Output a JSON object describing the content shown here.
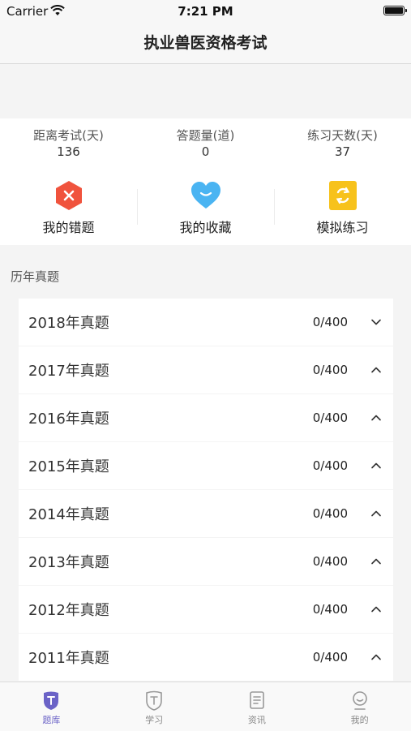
{
  "status_bar": {
    "carrier": "Carrier",
    "time": "7:21 PM"
  },
  "nav": {
    "title": "执业兽医资格考试"
  },
  "stats": [
    {
      "label": "距离考试(天)",
      "value": "136"
    },
    {
      "label": "答题量(道)",
      "value": "0"
    },
    {
      "label": "练习天数(天)",
      "value": "37"
    }
  ],
  "actions": [
    {
      "label": "我的错题",
      "icon": "wrong-questions-icon",
      "color": "#f0533d"
    },
    {
      "label": "我的收藏",
      "icon": "favorites-heart-icon",
      "color": "#4ab4f2"
    },
    {
      "label": "模拟练习",
      "icon": "mock-practice-icon",
      "color": "#f7c21c"
    }
  ],
  "section_title": "历年真题",
  "years": [
    {
      "title": "2018年真题",
      "progress": "0/400",
      "chevron": "down"
    },
    {
      "title": "2017年真题",
      "progress": "0/400",
      "chevron": "up"
    },
    {
      "title": "2016年真题",
      "progress": "0/400",
      "chevron": "up"
    },
    {
      "title": "2015年真题",
      "progress": "0/400",
      "chevron": "up"
    },
    {
      "title": "2014年真题",
      "progress": "0/400",
      "chevron": "up"
    },
    {
      "title": "2013年真题",
      "progress": "0/400",
      "chevron": "up"
    },
    {
      "title": "2012年真题",
      "progress": "0/400",
      "chevron": "up"
    },
    {
      "title": "2011年真题",
      "progress": "0/400",
      "chevron": "up"
    }
  ],
  "tabs": [
    {
      "label": "题库",
      "icon": "question-bank-icon",
      "active": true
    },
    {
      "label": "学习",
      "icon": "study-icon",
      "active": false
    },
    {
      "label": "资讯",
      "icon": "news-icon",
      "active": false
    },
    {
      "label": "我的",
      "icon": "profile-icon",
      "active": false
    }
  ],
  "colors": {
    "accent": "#6b63c7",
    "background": "#f4f4f4"
  }
}
